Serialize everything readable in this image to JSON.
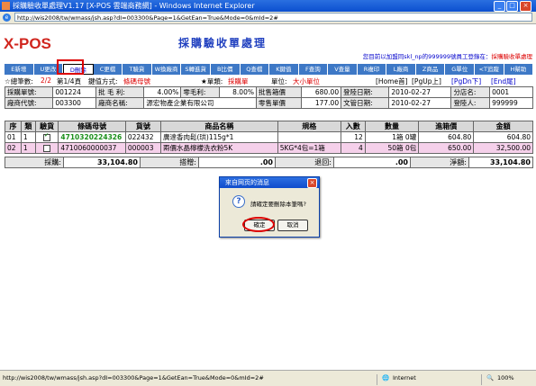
{
  "window": {
    "title": "採購驗收單處理V1.17 [X-POS 雲端商務網] - Windows Internet Explorer",
    "address": "http://wis2008/tw/wmass/jsh.asp?dI=003300&Page=1&GetEan=True&Mode=0&mId=2#"
  },
  "app": {
    "logo": "X-POS",
    "page_title": "採購驗收單處理",
    "user_prefix": "您目前以加盟同skl_np的999999號員工登錄在：",
    "user_module": "採購驗收單處理"
  },
  "toolbar": [
    {
      "label": "E新增",
      "active": false
    },
    {
      "label": "U更改",
      "active": false
    },
    {
      "label": "D刪除",
      "active": true
    },
    {
      "label": "C更檔",
      "active": false
    },
    {
      "label": "T驗貨",
      "active": false
    },
    {
      "label": "W換廠商",
      "active": false
    },
    {
      "label": "S轉進貨",
      "active": false
    },
    {
      "label": "B比價",
      "active": false
    },
    {
      "label": "Q查檔",
      "active": false
    },
    {
      "label": "K鍵值",
      "active": false
    },
    {
      "label": "F查詢",
      "active": false
    },
    {
      "label": "V查量",
      "active": false
    },
    {
      "label": "R複印",
      "active": false
    },
    {
      "label": "L廠商",
      "active": false
    },
    {
      "label": "Z商品",
      "active": false
    },
    {
      "label": "G單位",
      "active": false
    },
    {
      "label": "<T追蹤",
      "active": false
    },
    {
      "label": "H幫助",
      "active": false
    }
  ],
  "status": {
    "total_prefix": "☆總筆數:",
    "total_value": "2/2",
    "page_info": "第1/4頁",
    "key_label": "鍵值方式:",
    "key_value": "條碼母號",
    "type_label": "★單類:",
    "type_value": "採購單",
    "unit_label": "單位:",
    "unit_value": "大小單位",
    "nav_first": "[Home首]",
    "nav_prev": "[PgUp上]",
    "nav_next": "[PgDn下]",
    "nav_last": "[End尾]"
  },
  "info": {
    "order_no_label": "採購單號:",
    "order_no": "001224",
    "margin_label": "批 毛 利:",
    "margin_value": "4.00%",
    "zero_margin_label": "零毛利:",
    "zero_margin_value": "8.00%",
    "wholesale_label": "批售箱價",
    "wholesale_value": "680.00",
    "reg_date_label": "登陸日期:",
    "reg_date": "2010-02-27",
    "branch_label": "分店名:",
    "branch_value": "0001",
    "vendor_code_label": "廠商代號:",
    "vendor_code": "003300",
    "vendor_name_label": "廠商名稱:",
    "vendor_name": "源宏物產企業有限公司",
    "retail_label": "零售單價",
    "retail_value": "177.00",
    "doc_date_label": "文管日期:",
    "doc_date": "2010-02-27",
    "loginer_label": "登陸人:",
    "loginer_value": "999999"
  },
  "grid": {
    "headers": [
      "序",
      "類",
      "驗貨",
      "條碼母號",
      "貨號",
      "商品名稱",
      "規格",
      "入數",
      "數量",
      "進箱價",
      "金額"
    ],
    "rows": [
      {
        "seq": "01",
        "type": "1",
        "checked": true,
        "barcode": "4710320224326",
        "code": "022432",
        "name": "廣達香肉鬆(珙)115g*1",
        "spec": "",
        "count": "12",
        "qty": "1箱 0罐",
        "price": "604.80",
        "amount": "604.80"
      },
      {
        "seq": "02",
        "type": "1",
        "checked": false,
        "barcode": "4710060000037",
        "code": "000003",
        "name": "兩價水晶檸檬洗衣粉5K",
        "spec": "5KG*4包=1箱",
        "count": "4",
        "qty": "50箱 0包",
        "price": "650.00",
        "amount": "32,500.00"
      }
    ]
  },
  "totals": {
    "purchase_label": "採購:",
    "purchase_value": "33,104.80",
    "gift_label": "搭贈:",
    "gift_value": ".00",
    "return_label": "退回:",
    "return_value": ".00",
    "net_label": "淨額:",
    "net_value": "33,104.80"
  },
  "dialog": {
    "title": "來自网页的消息",
    "message": "請確定要刪除本筆嗎?",
    "ok": "確定",
    "cancel": "取消"
  },
  "statusbar": {
    "url": "http://wis2008/tw/wmass/jsh.asp?dI=003300&Page=1&GetEan=True&Mode=0&mId=2#",
    "zone": "Internet",
    "zoom": "100%"
  }
}
